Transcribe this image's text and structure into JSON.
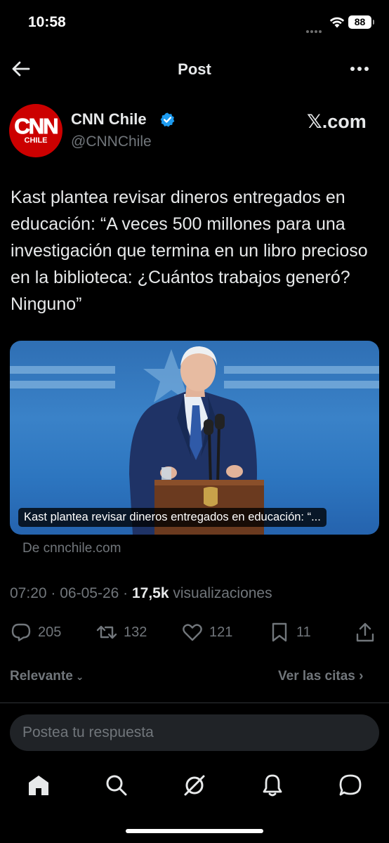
{
  "status_bar": {
    "time": "10:58",
    "battery": "88"
  },
  "header": {
    "title": "Post"
  },
  "author": {
    "avatar_text": "CNN",
    "avatar_subtext": "CHILE",
    "name": "CNN Chile",
    "handle": "@CNNChile",
    "source_badge": "𝕏.com"
  },
  "tweet": {
    "text": "Kast plantea revisar dineros entregados en educación: “A veces 500 millones para una investigación que termina en un libro precioso en la biblioteca: ¿Cuántos trabajos generó? Ninguno”",
    "media_caption": "Kast plantea revisar dineros entregados en educación: “...",
    "source": "De cnnchile.com",
    "time": "07:20",
    "date": "06-05-26",
    "views": "17,5k",
    "views_label": "visualizaciones"
  },
  "actions": {
    "replies": "205",
    "reposts": "132",
    "likes": "121",
    "bookmarks": "11"
  },
  "filters": {
    "sort_label": "Relevante",
    "quotes_label": "Ver las citas"
  },
  "reply": {
    "placeholder": "Postea tu respuesta"
  },
  "colors": {
    "background": "#000000",
    "text": "#e7e9ea",
    "secondary": "#71767b",
    "verified": "#1d9bf0",
    "brand_red": "#cc0000"
  },
  "nav": {
    "icons": [
      "home-icon",
      "search-icon",
      "grok-icon",
      "notifications-icon",
      "messages-icon"
    ]
  }
}
